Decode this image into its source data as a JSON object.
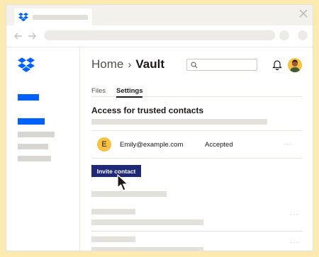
{
  "colors": {
    "background": "#fdeab0",
    "accent_blue": "#0061fe",
    "invite_button": "#1e2a78",
    "avatar_yellow": "#f7c244"
  },
  "icons": {
    "logo": "dropbox-icon",
    "close": "close-icon",
    "back": "arrow-left-icon",
    "forward": "arrow-right-icon",
    "search": "search-icon",
    "notifications": "bell-icon",
    "pointer": "cursor-arrow-icon"
  },
  "header": {
    "breadcrumb_home": "Home",
    "breadcrumb_separator": "›",
    "breadcrumb_current": "Vault"
  },
  "tabs": [
    {
      "label": "Files",
      "active": false
    },
    {
      "label": "Settings",
      "active": true
    }
  ],
  "section": {
    "title": "Access for trusted contacts"
  },
  "contact": {
    "initial": "E",
    "email": "Emily@example.com",
    "status": "Accepted",
    "more": "···"
  },
  "invite_button": "Invite contact",
  "list_more": "···"
}
